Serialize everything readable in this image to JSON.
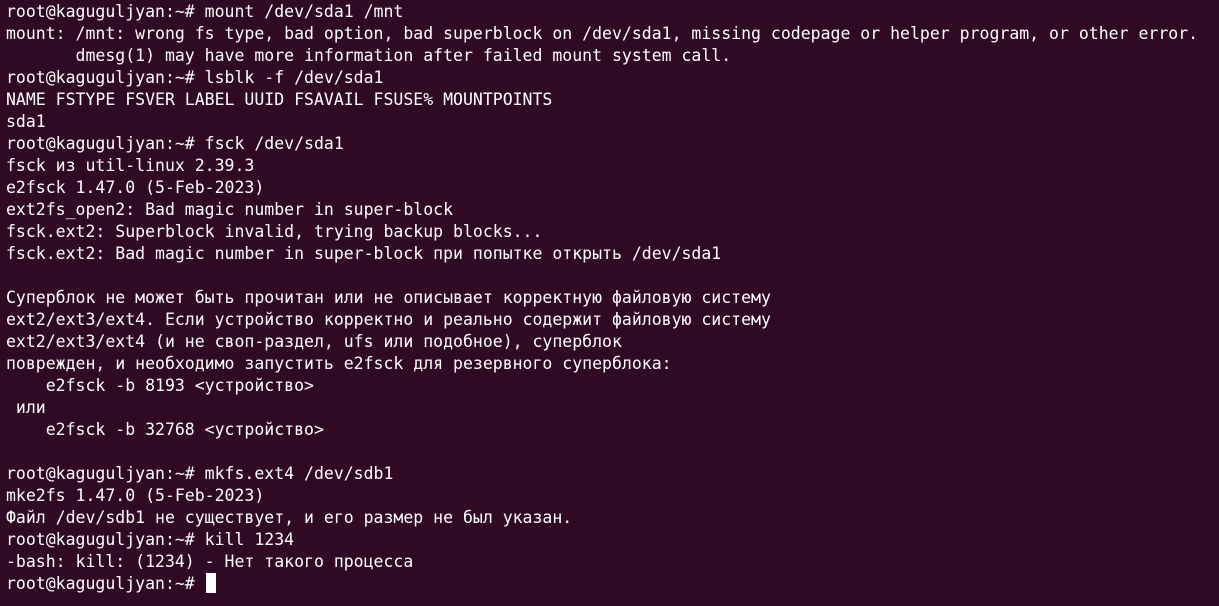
{
  "terminal": {
    "lines": [
      "root@kaguguljyan:~# mount /dev/sda1 /mnt",
      "mount: /mnt: wrong fs type, bad option, bad superblock on /dev/sda1, missing codepage or helper program, or other error.",
      "       dmesg(1) may have more information after failed mount system call.",
      "root@kaguguljyan:~# lsblk -f /dev/sda1",
      "NAME FSTYPE FSVER LABEL UUID FSAVAIL FSUSE% MOUNTPOINTS",
      "sda1",
      "root@kaguguljyan:~# fsck /dev/sda1",
      "fsck из util-linux 2.39.3",
      "e2fsck 1.47.0 (5-Feb-2023)",
      "ext2fs_open2: Bad magic number in super-block",
      "fsck.ext2: Superblock invalid, trying backup blocks...",
      "fsck.ext2: Bad magic number in super-block при попытке открыть /dev/sda1",
      "",
      "Суперблок не может быть прочитан или не описывает корректную файловую систему",
      "ext2/ext3/ext4. Если устройство корректно и реально содержит файловую систему",
      "ext2/ext3/ext4 (и не своп-раздел, ufs или подобное), суперблок",
      "поврежден, и необходимо запустить e2fsck для резервного суперблока:",
      "    e2fsck -b 8193 <устройство>",
      " или",
      "    e2fsck -b 32768 <устройство>",
      "",
      "root@kaguguljyan:~# mkfs.ext4 /dev/sdb1",
      "mke2fs 1.47.0 (5-Feb-2023)",
      "Файл /dev/sdb1 не существует, и его размер не был указан.",
      "root@kaguguljyan:~# kill 1234",
      "-bash: kill: (1234) - Нет такого процесса"
    ],
    "prompt": "root@kaguguljyan:~# "
  }
}
